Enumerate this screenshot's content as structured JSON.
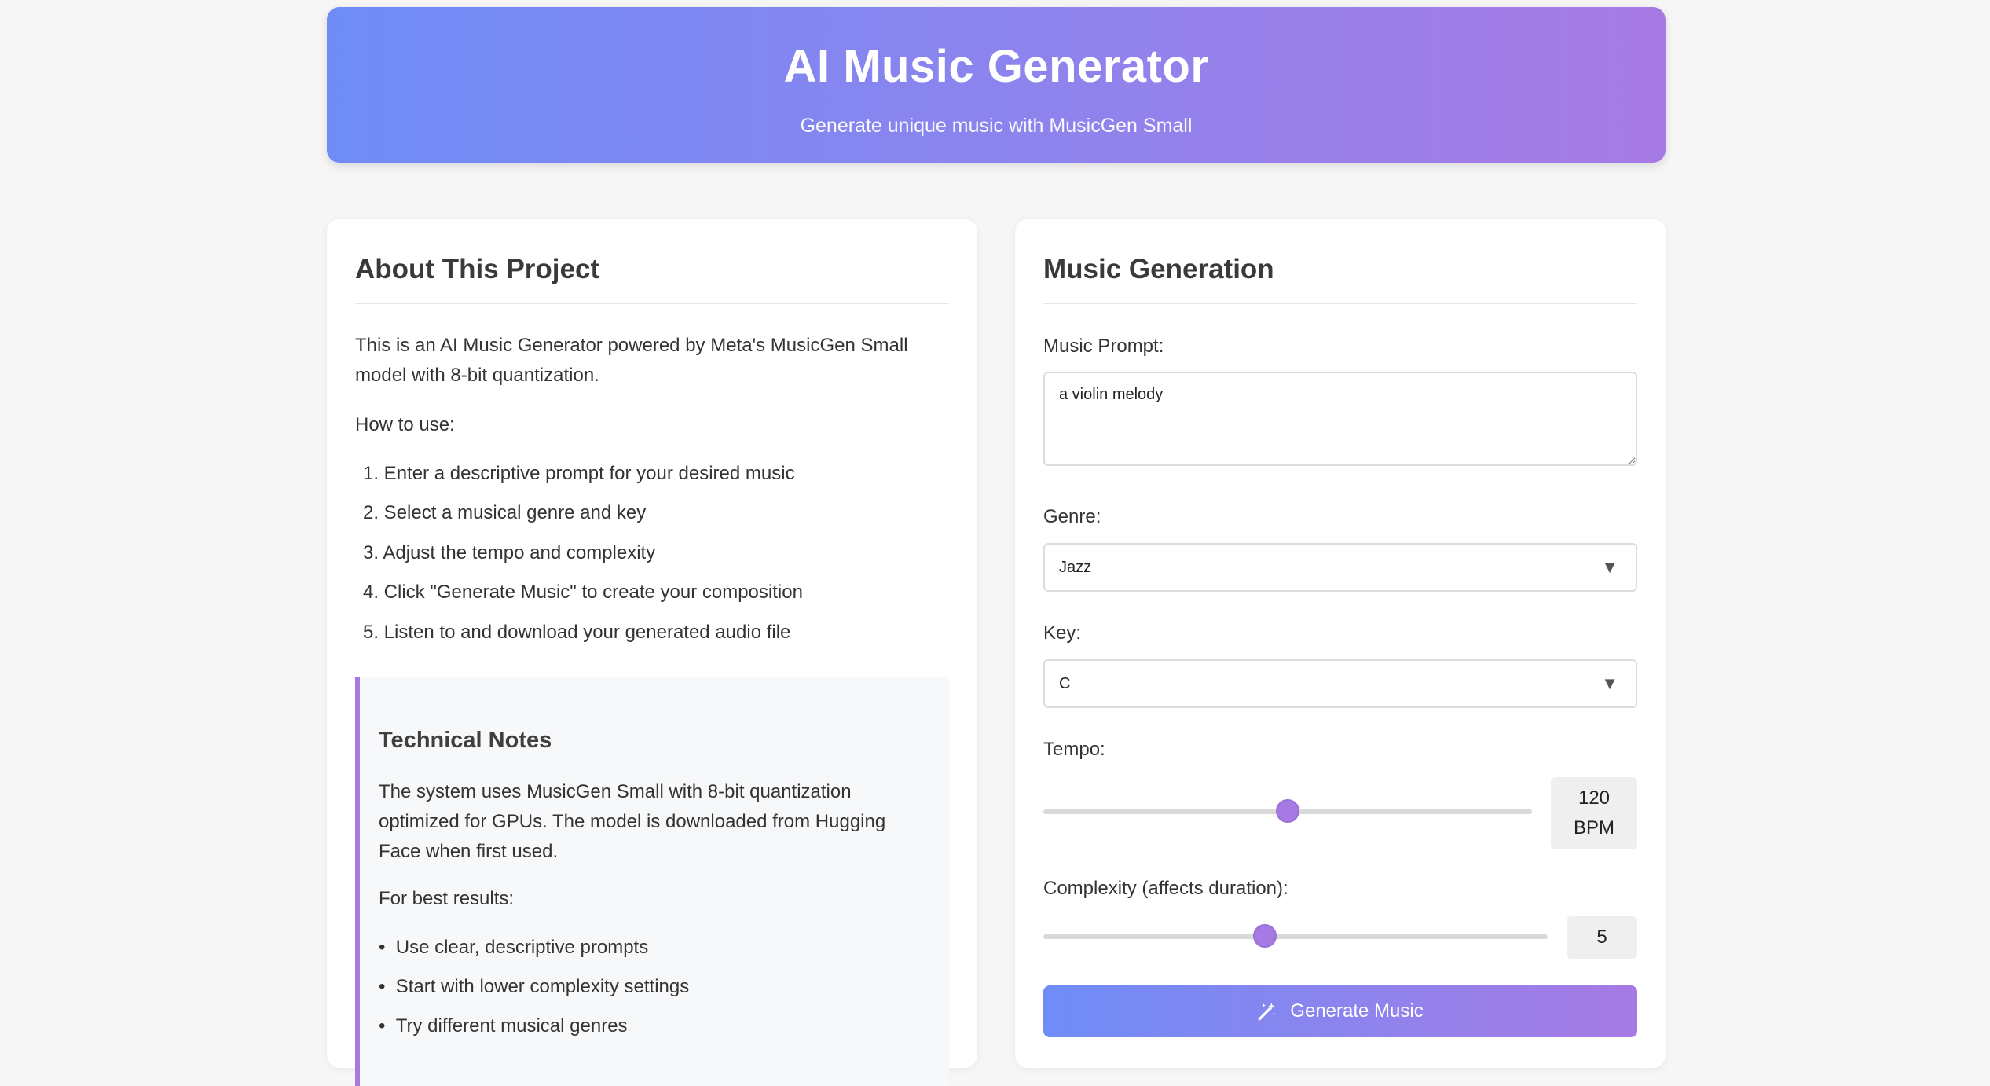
{
  "header": {
    "title": "AI Music Generator",
    "subtitle": "Generate unique music with MusicGen Small"
  },
  "about": {
    "title": "About This Project",
    "intro": "This is an AI Music Generator powered by Meta's MusicGen Small model with 8-bit quantization.",
    "how_to_label": "How to use:",
    "steps": [
      "1. Enter a descriptive prompt for your desired music",
      "2. Select a musical genre and key",
      "3. Adjust the tempo and complexity",
      "4. Click \"Generate Music\" to create your composition",
      "5. Listen to and download your generated audio file"
    ],
    "notes": {
      "title": "Technical Notes",
      "body": "The system uses MusicGen Small with 8-bit quantization optimized for GPUs. The model is downloaded from Hugging Face when first used.",
      "best_label": "For best results:",
      "tips": [
        "Use clear, descriptive prompts",
        "Start with lower complexity settings",
        "Try different musical genres"
      ]
    }
  },
  "generation": {
    "title": "Music Generation",
    "prompt_label": "Music Prompt:",
    "prompt_value": "a violin melody",
    "genre_label": "Genre:",
    "genre_value": "Jazz",
    "key_label": "Key:",
    "key_value": "C",
    "tempo_label": "Tempo:",
    "tempo_value": "120",
    "tempo_unit": "BPM",
    "tempo_fraction": 0.5,
    "complexity_label": "Complexity (affects duration):",
    "complexity_value": "5",
    "complexity_fraction": 0.44,
    "button_label": "Generate Music",
    "button_icon": "magic-wand-icon",
    "select_icon": "chevron-down-icon"
  },
  "colors": {
    "accent_start": "#6f8cf6",
    "accent_end": "#a77ae3"
  }
}
